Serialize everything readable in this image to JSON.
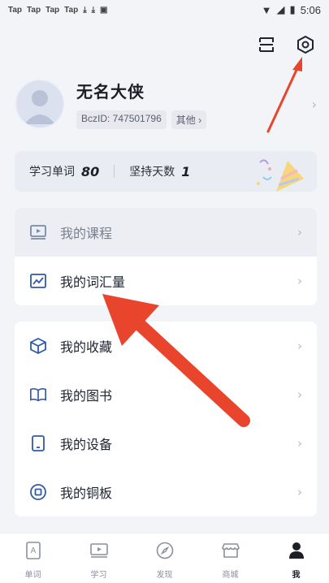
{
  "status_bar": {
    "left_items": [
      "Tap",
      "Tap",
      "Tap",
      "Tap"
    ],
    "time": "5:06"
  },
  "header": {
    "icons": [
      "scan-icon",
      "settings-gear-icon"
    ]
  },
  "profile": {
    "name": "无名大侠",
    "id_label": "BczID: 747501796",
    "other_label": "其他 ›"
  },
  "stats": {
    "words_label": "学习单词",
    "words_value": "80",
    "days_label": "坚持天数",
    "days_value": "1"
  },
  "menu_top": [
    {
      "label": "我的课程",
      "icon": "course-icon"
    },
    {
      "label": "我的词汇量",
      "icon": "vocabulary-chart-icon"
    }
  ],
  "menu_bottom": [
    {
      "label": "我的收藏",
      "icon": "collection-cube-icon"
    },
    {
      "label": "我的图书",
      "icon": "book-icon"
    },
    {
      "label": "我的设备",
      "icon": "device-icon"
    },
    {
      "label": "我的铜板",
      "icon": "coin-icon"
    }
  ],
  "tabs": [
    {
      "label": "单词",
      "icon": "word-card-icon"
    },
    {
      "label": "学习",
      "icon": "study-screen-icon"
    },
    {
      "label": "发现",
      "icon": "compass-icon"
    },
    {
      "label": "商城",
      "icon": "shop-icon"
    },
    {
      "label": "我",
      "icon": "person-icon"
    }
  ],
  "colors": {
    "accent_arrow": "#e8452c",
    "icon_blue": "#2f5aa8",
    "background": "#f3f4f7"
  }
}
